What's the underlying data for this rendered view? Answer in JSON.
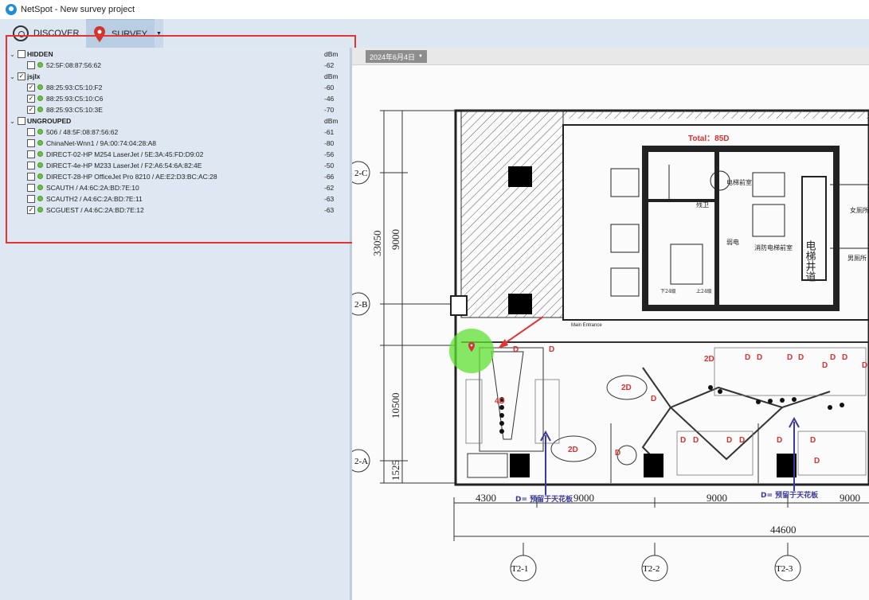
{
  "window": {
    "title": "NetSpot - New survey project"
  },
  "toolbar": {
    "discover_label": "DISCOVER",
    "survey_label": "SURVEY",
    "dropdown_glyph": "▼"
  },
  "networks": {
    "column_unit": "dBm",
    "groups": [
      {
        "name": "HIDDEN",
        "checked": false,
        "unit": "dBm",
        "items": [
          {
            "label": "52:5F:08:87:56:62",
            "value": "-62",
            "checked": false
          }
        ]
      },
      {
        "name": "jsjlx",
        "checked": true,
        "unit": "dBm",
        "items": [
          {
            "label": "88:25:93:C5:10:F2",
            "value": "-60",
            "checked": true
          },
          {
            "label": "88:25:93:C5:10:C6",
            "value": "-46",
            "checked": true
          },
          {
            "label": "88:25:93:C5:10:3E",
            "value": "-70",
            "checked": true
          }
        ]
      },
      {
        "name": "UNGROUPED",
        "checked": false,
        "unit": "dBm",
        "items": [
          {
            "label": "506 / 48:5F:08:87:56:62",
            "value": "-61",
            "checked": false
          },
          {
            "label": "ChinaNet-Wnn1 / 9A:00:74:04:28:A8",
            "value": "-80",
            "checked": false
          },
          {
            "label": "DIRECT-02-HP M254 LaserJet / 5E:3A:45:FD:D9:02",
            "value": "-56",
            "checked": false
          },
          {
            "label": "DIRECT-4e-HP M233 LaserJet / F2:A6:54:6A:82:4E",
            "value": "-50",
            "checked": false
          },
          {
            "label": "DIRECT-28-HP OfficeJet Pro 8210 / AE:E2:D3:BC:AC:28",
            "value": "-66",
            "checked": false
          },
          {
            "label": "SCAUTH / A4:6C:2A:BD:7E:10",
            "value": "-62",
            "checked": false
          },
          {
            "label": "SCAUTH2 / A4:6C:2A:BD:7E:11",
            "value": "-63",
            "checked": false
          },
          {
            "label": "SCGUEST / A4:6C:2A:BD:7E:12",
            "value": "-63",
            "checked": true
          }
        ]
      }
    ]
  },
  "map": {
    "date_label": "2024年6月4日",
    "total_label": "Total：85D",
    "dimensions": {
      "v_33050": "33050",
      "v_9000": "9000",
      "v_10500": "10500",
      "v_1525": "1525",
      "h_4300": "4300",
      "h_9000a": "9000",
      "h_9000b": "9000",
      "h_9000c": "9000",
      "h_44600": "44600"
    },
    "grid_labels": [
      "2-C",
      "2-B",
      "2-A",
      "T2-1",
      "T2-2",
      "T2-3"
    ],
    "room_labels": {
      "elevator_shaft": "电梯井道",
      "elevator_hall": "电梯前室",
      "fire_elevator": "消防电梯前室",
      "weak_current": "弱电",
      "well": "残卫",
      "womens_wc": "女厕所",
      "mens_wc": "男厕所",
      "stair_up": "上24级",
      "stair_down": "下24级",
      "main_entrance": "Main Entrance"
    },
    "markers": [
      "D",
      "D",
      "4D",
      "2D",
      "2D",
      "2D",
      "D",
      "D",
      "D",
      "D",
      "D",
      "D",
      "D",
      "D",
      "D",
      "D",
      "D",
      "D",
      "D",
      "D",
      "D",
      "D",
      "D"
    ],
    "annotation_left": "D= 预留于天花板",
    "annotation_right": "D= 预留于天花板"
  },
  "colors": {
    "highlight": "#e53232",
    "signal": "#6ec044",
    "marker": "#d93030",
    "annotation": "#3a3a9a",
    "probe": "#5fe032"
  }
}
